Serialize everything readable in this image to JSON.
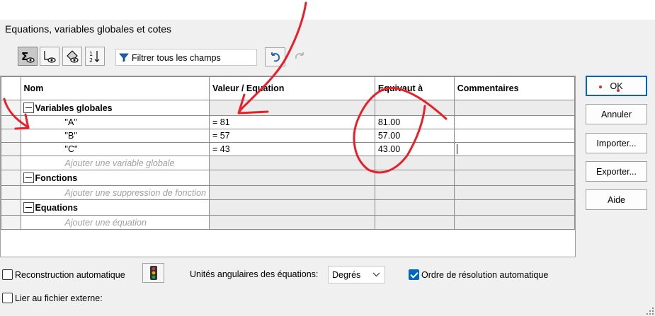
{
  "window": {
    "title": "Equations, variables globales et cotes"
  },
  "toolbar": {
    "buttons": [
      {
        "icon": "sigma-eye-icon",
        "active": true
      },
      {
        "icon": "dimension-eye-icon",
        "active": false
      },
      {
        "icon": "equation-view-icon",
        "active": false
      },
      {
        "icon": "sort-order-icon",
        "active": false
      }
    ],
    "filter_label": "Filtrer tous les champs",
    "undo_icon": "undo-icon",
    "redo_icon": "redo-icon"
  },
  "grid": {
    "headers": [
      "Nom",
      "Valeur / Equation",
      "Equivaut à",
      "Commentaires"
    ],
    "groups": {
      "globals": {
        "label": "Variables globales",
        "rows": [
          {
            "name": "\"A\"",
            "value": "= 81",
            "result": "81.00",
            "comment": ""
          },
          {
            "name": "\"B\"",
            "value": "= 57",
            "result": "57.00",
            "comment": ""
          },
          {
            "name": "\"C\"",
            "value": "= 43",
            "result": "43.00",
            "comment": ""
          }
        ],
        "placeholder": "Ajouter une variable globale"
      },
      "functions": {
        "label": "Fonctions",
        "placeholder": "Ajouter une suppression de fonction"
      },
      "equations": {
        "label": "Equations",
        "placeholder": "Ajouter une équation"
      }
    }
  },
  "side_buttons": {
    "ok": "OK",
    "cancel": "Annuler",
    "import": "Importer...",
    "export": "Exporter...",
    "help": "Aide"
  },
  "footer": {
    "auto_rebuild": {
      "label": "Reconstruction automatique",
      "checked": false
    },
    "traffic_icon": "traffic-light-icon",
    "angular_units_label": "Unités angulaires des équations:",
    "angular_units_value": "Degrés",
    "auto_order": {
      "label": "Ordre de résolution automatique",
      "checked": true
    },
    "link_external": {
      "label": "Lier au fichier externe:",
      "checked": false
    }
  },
  "colors": {
    "accent": "#0067c0",
    "annotation": "#e8202a"
  }
}
